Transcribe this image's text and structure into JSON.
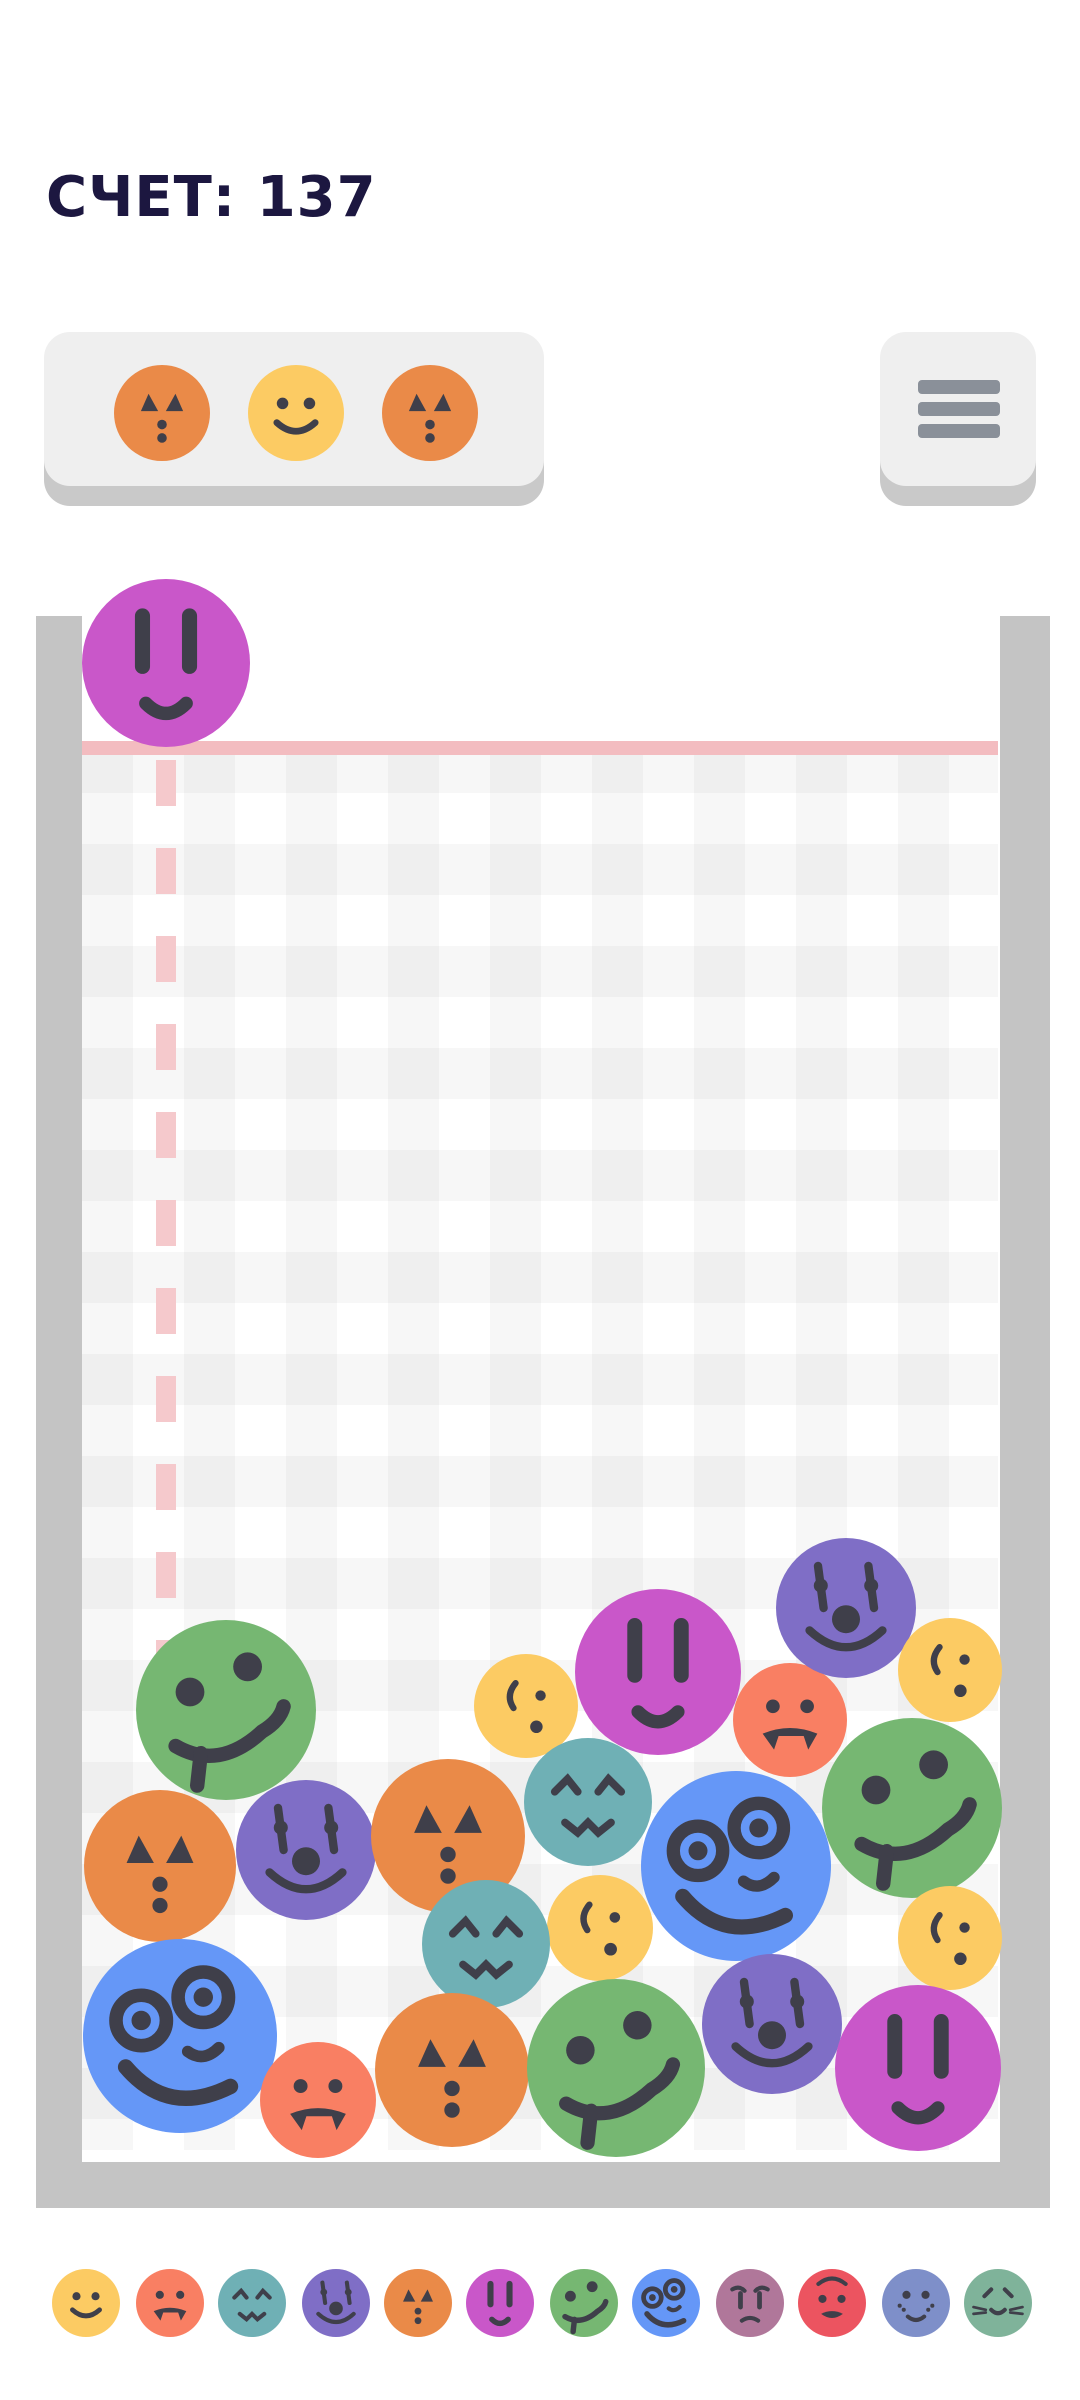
{
  "score": {
    "label": "СЧЕТ: 137"
  },
  "colors": {
    "yellow": "#fccb63",
    "coral": "#f97f63",
    "teal": "#6fb0b5",
    "purple": "#7f6ec6",
    "orange": "#ea8a48",
    "magenta": "#c957c9",
    "green": "#76b772",
    "blue": "#6597f7",
    "mauve": "#b0779a",
    "red": "#ec5460",
    "slate_blue": "#7e8fc9",
    "mint": "#7fb39a",
    "face": "#3f3f4a",
    "wall": "#c4c4c4",
    "danger": "#f3bcc0"
  },
  "next_queue": [
    {
      "type": "pumpkin",
      "color": "orange",
      "icon": "pumpkin-face-icon"
    },
    {
      "type": "smile",
      "color": "yellow",
      "icon": "smile-face-icon"
    },
    {
      "type": "pumpkin",
      "color": "orange",
      "icon": "pumpkin-face-icon"
    }
  ],
  "menu": {
    "icon": "hamburger-menu-icon"
  },
  "current_ball": {
    "type": "tall-eyes",
    "color": "magenta",
    "icon": "tall-eyes-face-icon"
  },
  "balls_in_container": [
    {
      "type": "cheeky",
      "color": "green"
    },
    {
      "type": "pumpkin",
      "color": "orange"
    },
    {
      "type": "clown",
      "color": "purple"
    },
    {
      "type": "pumpkin",
      "color": "orange"
    },
    {
      "type": "smirk",
      "color": "yellow"
    },
    {
      "type": "tall-eyes",
      "color": "magenta"
    },
    {
      "type": "vampire",
      "color": "coral"
    },
    {
      "type": "clown",
      "color": "purple"
    },
    {
      "type": "smirk",
      "color": "yellow"
    },
    {
      "type": "sleepy",
      "color": "teal"
    },
    {
      "type": "googly",
      "color": "blue"
    },
    {
      "type": "cheeky",
      "color": "green"
    },
    {
      "type": "smirk",
      "color": "yellow"
    },
    {
      "type": "sleepy",
      "color": "teal"
    },
    {
      "type": "smirk",
      "color": "yellow"
    },
    {
      "type": "googly",
      "color": "blue"
    },
    {
      "type": "vampire",
      "color": "coral"
    },
    {
      "type": "pumpkin",
      "color": "orange"
    },
    {
      "type": "cheeky",
      "color": "green"
    },
    {
      "type": "clown",
      "color": "purple"
    },
    {
      "type": "tall-eyes",
      "color": "magenta"
    }
  ],
  "evolution_strip": [
    {
      "type": "smile",
      "color": "yellow"
    },
    {
      "type": "vampire",
      "color": "coral"
    },
    {
      "type": "sleepy",
      "color": "teal"
    },
    {
      "type": "clown",
      "color": "purple"
    },
    {
      "type": "pumpkin",
      "color": "orange"
    },
    {
      "type": "tall-eyes",
      "color": "magenta"
    },
    {
      "type": "cheeky",
      "color": "green"
    },
    {
      "type": "googly",
      "color": "blue"
    },
    {
      "type": "worried",
      "color": "mauve"
    },
    {
      "type": "devil",
      "color": "red"
    },
    {
      "type": "freckles",
      "color": "slate_blue"
    },
    {
      "type": "cat",
      "color": "mint"
    }
  ]
}
